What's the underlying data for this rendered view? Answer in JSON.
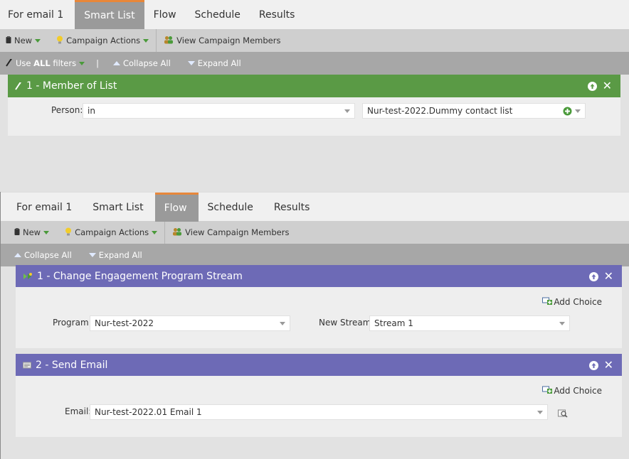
{
  "colors": {
    "smart_list_header": "#5a9a45",
    "flow_header": "#6d6ab6",
    "active_tab_accent": "#e8873a"
  },
  "top_panel": {
    "tabs": [
      "For email 1",
      "Smart List",
      "Flow",
      "Schedule",
      "Results"
    ],
    "active_tab": "Smart List",
    "toolbar": {
      "new_label": "New",
      "campaign_actions_label": "Campaign Actions",
      "view_members_label": "View Campaign Members"
    },
    "subbar": {
      "use_prefix": "Use ",
      "use_bold": "ALL",
      "use_suffix": " filters",
      "pipe": "|",
      "collapse_label": "Collapse All",
      "expand_label": "Expand All"
    },
    "filter": {
      "title": "1 - Member of List",
      "field_label": "Person:",
      "operator_value": "in",
      "list_value": "Nur-test-2022.Dummy contact list"
    }
  },
  "bottom_panel": {
    "tabs": [
      "For email 1",
      "Smart List",
      "Flow",
      "Schedule",
      "Results"
    ],
    "active_tab": "Flow",
    "toolbar": {
      "new_label": "New",
      "campaign_actions_label": "Campaign Actions",
      "view_members_label": "View Campaign Members"
    },
    "subbar": {
      "collapse_label": "Collapse All",
      "expand_label": "Expand All"
    },
    "steps": [
      {
        "title": "1 - Change Engagement Program Stream",
        "add_choice_label": "Add Choice",
        "program_label": "Program:",
        "program_value": "Nur-test-2022",
        "stream_label": "New Stream:",
        "stream_value": "Stream 1"
      },
      {
        "title": "2 - Send Email",
        "add_choice_label": "Add Choice",
        "email_label": "Email:",
        "email_value": "Nur-test-2022.01 Email 1"
      }
    ]
  }
}
